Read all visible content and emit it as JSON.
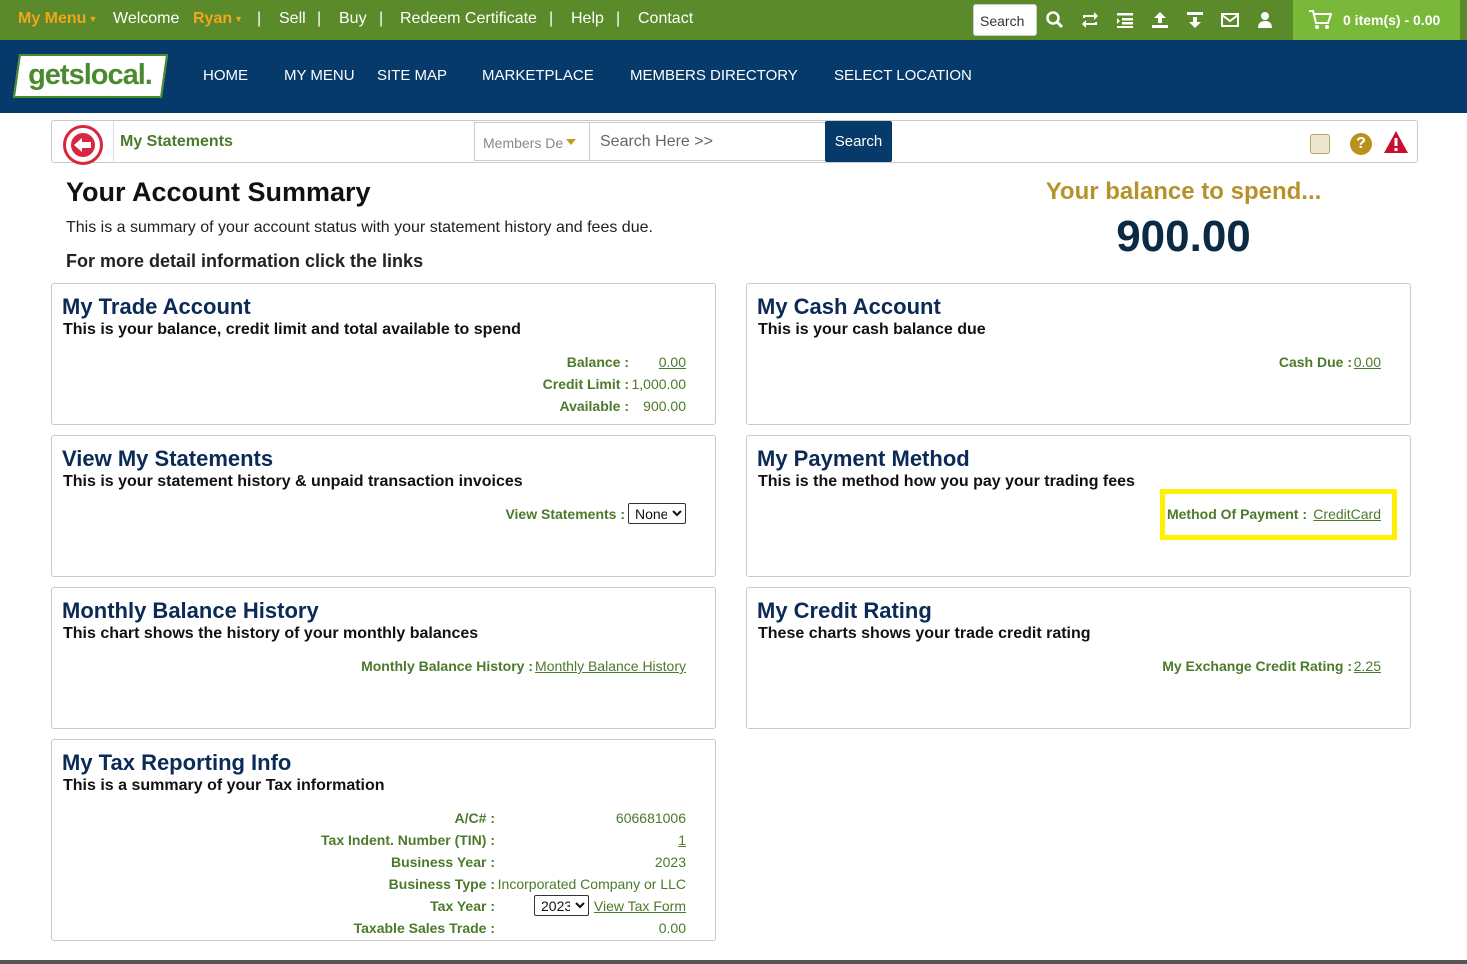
{
  "topbar": {
    "my_menu": "My Menu",
    "welcome": "Welcome",
    "user": "Ryan",
    "links": [
      "Sell",
      "Buy",
      "Redeem Certificate",
      "Help",
      "Contact"
    ],
    "separator": "|",
    "search_placeholder": "Search",
    "icons": [
      "search-icon",
      "exchange-icon",
      "list-icon",
      "upload-icon",
      "download-icon",
      "mail-icon",
      "user-icon"
    ],
    "cart": "0 item(s) - 0.00"
  },
  "nav": {
    "logo": "getslocal.",
    "items": [
      "HOME",
      "MY MENU",
      "SITE MAP",
      "MARKETPLACE",
      "MEMBERS DIRECTORY",
      "SELECT LOCATION"
    ]
  },
  "statements_bar": {
    "title": "My Statements",
    "select_value": "Members De",
    "search_placeholder": "Search Here >>",
    "search_button": "Search"
  },
  "summary": {
    "title": "Your Account Summary",
    "subtitle": "This is a summary of your account status with your statement history and fees due.",
    "detail": "For more detail information click the links",
    "balance_label": "Your balance to spend...",
    "balance_value": "900.00"
  },
  "trade": {
    "title": "My Trade Account",
    "subtitle": "This is your balance, credit limit and total available to spend",
    "balance_label": "Balance :",
    "balance_value": "0.00",
    "credit_label": "Credit Limit :",
    "credit_value": "1,000.00",
    "available_label": "Available :",
    "available_value": "900.00"
  },
  "cash": {
    "title": "My Cash Account",
    "subtitle": "This is your cash balance due",
    "due_label": "Cash Due :",
    "due_value": "0.00"
  },
  "statements": {
    "title": "View My Statements",
    "subtitle": "This is your statement history & unpaid transaction invoices",
    "label": "View Statements :",
    "select_value": "None"
  },
  "payment": {
    "title": "My Payment Method",
    "subtitle": "This is the method how you pay your trading fees",
    "label": "Method Of Payment :",
    "value": "CreditCard",
    "highlight_color": "#ffef00"
  },
  "monthly": {
    "title": "Monthly Balance History",
    "subtitle": "This chart shows the history of your monthly balances",
    "label": "Monthly Balance History :",
    "link": "Monthly Balance History"
  },
  "credit": {
    "title": "My Credit Rating",
    "subtitle": "These charts shows your trade credit rating",
    "label": "My Exchange Credit Rating :",
    "value": "2.25"
  },
  "tax": {
    "title": "My Tax Reporting Info",
    "subtitle": "This is a summary of your Tax information",
    "ac_label": "A/C# :",
    "ac_value": "606681006",
    "tin_label": "Tax Indent. Number (TIN) :",
    "tin_value": "1",
    "year_label": "Business Year :",
    "year_value": "2023",
    "type_label": "Business Type :",
    "type_value": "Incorporated Company or LLC",
    "taxyear_label": "Tax Year :",
    "taxyear_value": "2023",
    "taxform_link": "View Tax Form",
    "taxable_label": "Taxable Sales Trade :",
    "taxable_value": "0.00"
  },
  "colors": {
    "topbar": "#5a8a2a",
    "nav": "#063a6a",
    "accent_green": "#4b7a2a",
    "gold": "#b5922a"
  }
}
